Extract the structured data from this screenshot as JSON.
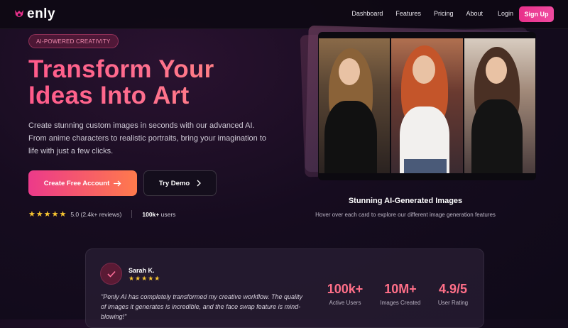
{
  "nav": {
    "logo_text": "enly",
    "links": [
      "Dashboard",
      "Features",
      "Pricing",
      "About"
    ],
    "login": "Login",
    "signup": "Sign Up"
  },
  "hero": {
    "badge": "AI-POWERED CREATIVITY",
    "headline_line1": "Transform Your",
    "headline_line2": "Ideas Into Art",
    "description": "Create stunning custom images in seconds with our advanced AI. From anime characters to realistic portraits, bring your imagination to life with just a few clicks.",
    "primary_button": "Create Free Account",
    "secondary_button": "Try Demo",
    "rating_stars": "★★★★★",
    "rating_text": "5.0 (2.4k+ reviews)",
    "users_count": "100k+",
    "users_label": "users"
  },
  "gallery": {
    "title": "Stunning AI-Generated Images",
    "subtitle": "Hover over each card to explore our different image generation features"
  },
  "testimonial": {
    "name": "Sarah K.",
    "stars": "★★★★★",
    "quote": "\"Penly AI has completely transformed my creative workflow. The quality of images it generates is incredible, and the face swap feature is mind-blowing!\""
  },
  "stats": [
    {
      "value": "100k+",
      "label": "Active Users"
    },
    {
      "value": "10M+",
      "label": "Images Created"
    },
    {
      "value": "4.9/5",
      "label": "User Rating"
    }
  ],
  "colors": {
    "accent": "#e8308a",
    "star": "#f7c531",
    "background": "#160c1f"
  }
}
